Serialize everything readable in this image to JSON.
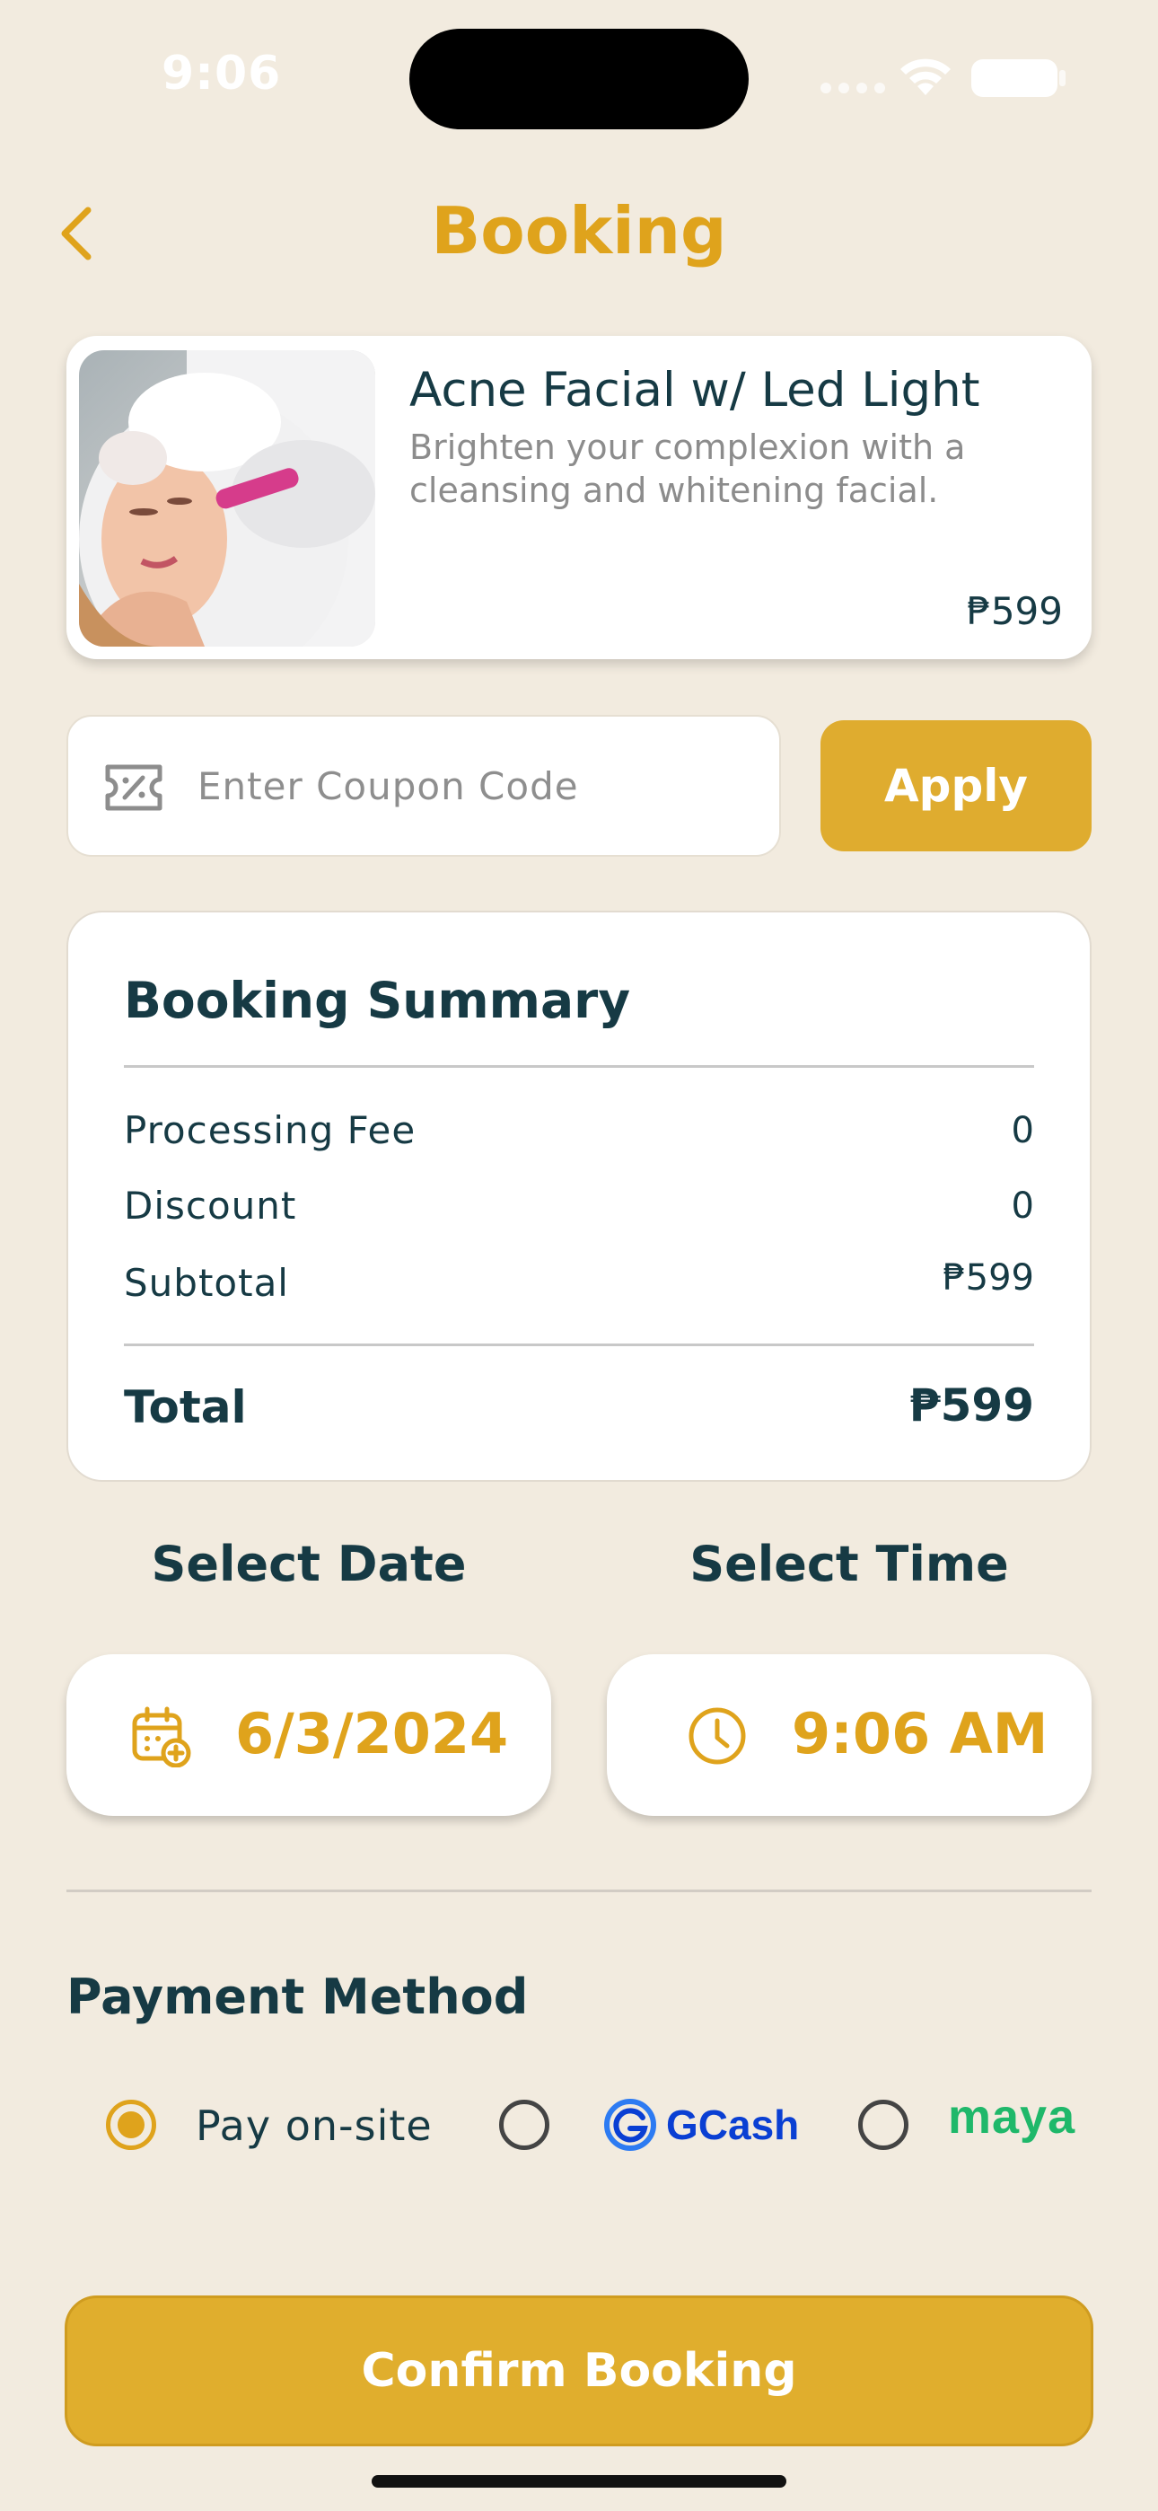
{
  "status_bar": {
    "time": "9:06"
  },
  "header": {
    "title": "Booking"
  },
  "service": {
    "name": "Acne Facial w/ Led Light",
    "description": "Brighten your complexion with a cleansing and whitening facial.",
    "price": "₱599"
  },
  "coupon": {
    "placeholder": "Enter Coupon Code",
    "value": "",
    "apply_label": "Apply"
  },
  "summary": {
    "title": "Booking Summary",
    "rows": [
      {
        "label": "Processing Fee",
        "value": "0"
      },
      {
        "label": "Discount",
        "value": "0"
      },
      {
        "label": "Subtotal",
        "value": "₱599"
      }
    ],
    "total_label": "Total",
    "total_value": "₱599"
  },
  "schedule": {
    "date_label": "Select Date",
    "date_value": "6/3/2024",
    "time_label": "Select Time",
    "time_value": "9:06 AM"
  },
  "payment": {
    "title": "Payment Method",
    "options": [
      {
        "label": "Pay on-site",
        "selected": true
      },
      {
        "label": "GCash",
        "selected": false
      },
      {
        "label": "maya",
        "selected": false
      }
    ]
  },
  "confirm_label": "Confirm Booking",
  "colors": {
    "accent": "#dfa31c",
    "button": "#e0ae2d",
    "text": "#163a44",
    "background": "#f2ebdf"
  }
}
